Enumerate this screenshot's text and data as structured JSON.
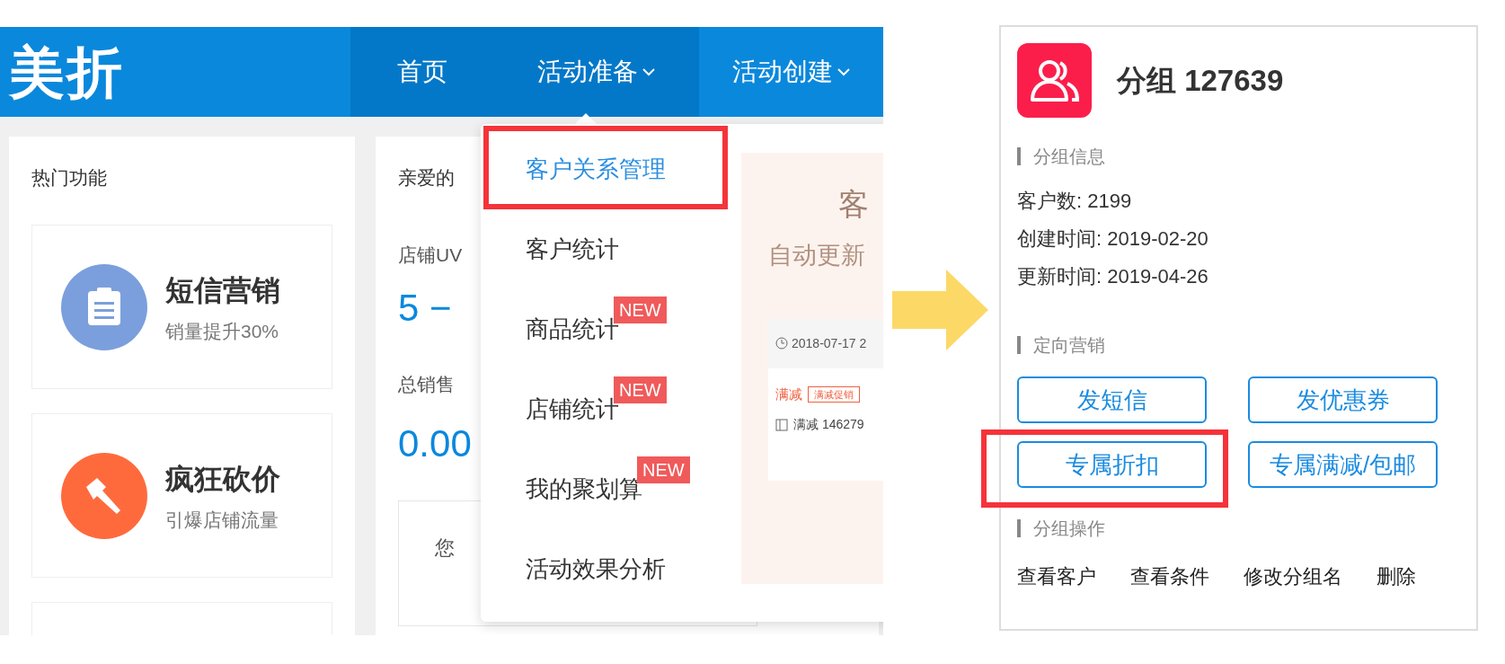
{
  "left_screenshot": {
    "logo": "美折",
    "nav": [
      {
        "label": "首页",
        "highlighted": true,
        "dropdown": false
      },
      {
        "label": "活动准备",
        "highlighted": true,
        "dropdown": true
      },
      {
        "label": "活动创建",
        "highlighted": false,
        "dropdown": true
      }
    ],
    "hot_features": {
      "title": "热门功能",
      "items": [
        {
          "title": "短信营销",
          "subtitle": "销量提升30%",
          "kind": "clipboard",
          "color": "#7b9fdc"
        },
        {
          "title": "疯狂砍价",
          "subtitle": "引爆店铺流量",
          "kind": "hammer",
          "color": "#ff6a3d"
        }
      ]
    },
    "overview": {
      "greeting": "亲爱的",
      "uv_label": "店铺UV",
      "uv_value": "5 −",
      "sales_label": "总销售",
      "sales_value": "0.00",
      "notice": "您"
    },
    "menu": {
      "items": [
        {
          "label": "客户关系管理",
          "selected": true,
          "annotated": true
        },
        {
          "label": "客户统计",
          "selected": false,
          "annotated": false
        },
        {
          "label": "商品统计",
          "selected": false,
          "annotated": false,
          "badge": "NEW"
        },
        {
          "label": "店铺统计",
          "selected": false,
          "annotated": false,
          "badge": "NEW"
        },
        {
          "label": "我的聚划算",
          "selected": false,
          "annotated": false,
          "badge": "NEW"
        },
        {
          "label": "活动效果分析",
          "selected": false,
          "annotated": false
        }
      ]
    },
    "promo": {
      "heading": "客",
      "subheading": "自动更新",
      "date": "2018-07-17 2",
      "type": "满减",
      "tag": "满减促销",
      "name": "满减 146279"
    }
  },
  "right_card": {
    "title": "分组 127639",
    "sections": [
      {
        "heading": "分组信息",
        "kind": "info",
        "lines": [
          "客户数: 2199",
          "创建时间: 2019-02-20",
          "更新时间: 2019-04-26"
        ]
      },
      {
        "heading": "定向营销",
        "kind": "buttons",
        "buttons": [
          {
            "label": "发短信",
            "annotated": false
          },
          {
            "label": "发优惠券",
            "annotated": false
          },
          {
            "label": "专属折扣",
            "annotated": true
          },
          {
            "label": "专属满减/包邮",
            "annotated": false
          }
        ]
      },
      {
        "heading": "分组操作",
        "kind": "links",
        "links": [
          "查看客户",
          "查看条件",
          "修改分组名",
          "删除"
        ]
      }
    ]
  }
}
